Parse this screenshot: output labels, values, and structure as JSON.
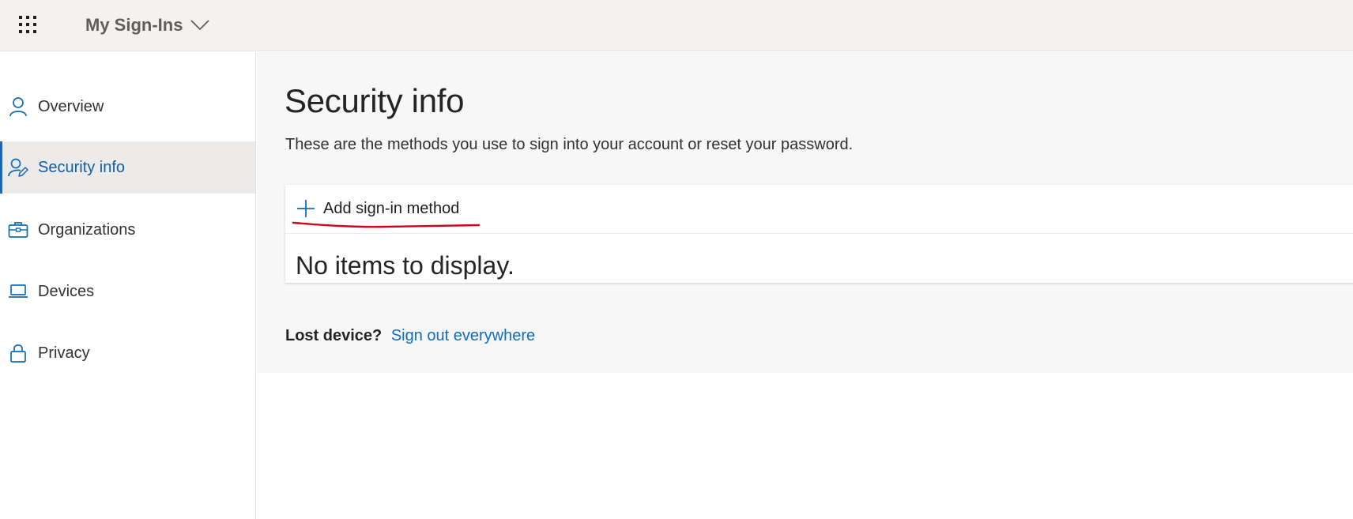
{
  "header": {
    "app_title": "My Sign-Ins",
    "waffle_icon": "app-launcher-icon",
    "dropdown_icon": "chevron-down-icon"
  },
  "sidebar": {
    "items": [
      {
        "label": "Overview",
        "icon": "person-icon",
        "active": false
      },
      {
        "label": "Security info",
        "icon": "person-edit-icon",
        "active": true
      },
      {
        "label": "Organizations",
        "icon": "briefcase-icon",
        "active": false
      },
      {
        "label": "Devices",
        "icon": "laptop-icon",
        "active": false
      },
      {
        "label": "Privacy",
        "icon": "lock-icon",
        "active": false
      }
    ]
  },
  "main": {
    "title": "Security info",
    "description": "These are the methods you use to sign into your account or reset your password.",
    "add_method_label": "Add sign-in method",
    "empty_message": "No items to display.",
    "lost_device_label": "Lost device?",
    "sign_out_link": "Sign out everywhere"
  },
  "colors": {
    "accent": "#0f6cbd",
    "annotation": "#d0021b",
    "topbar_bg": "#f3f2f1",
    "main_bg": "#f7f7f7",
    "active_bg": "#edebe9"
  }
}
